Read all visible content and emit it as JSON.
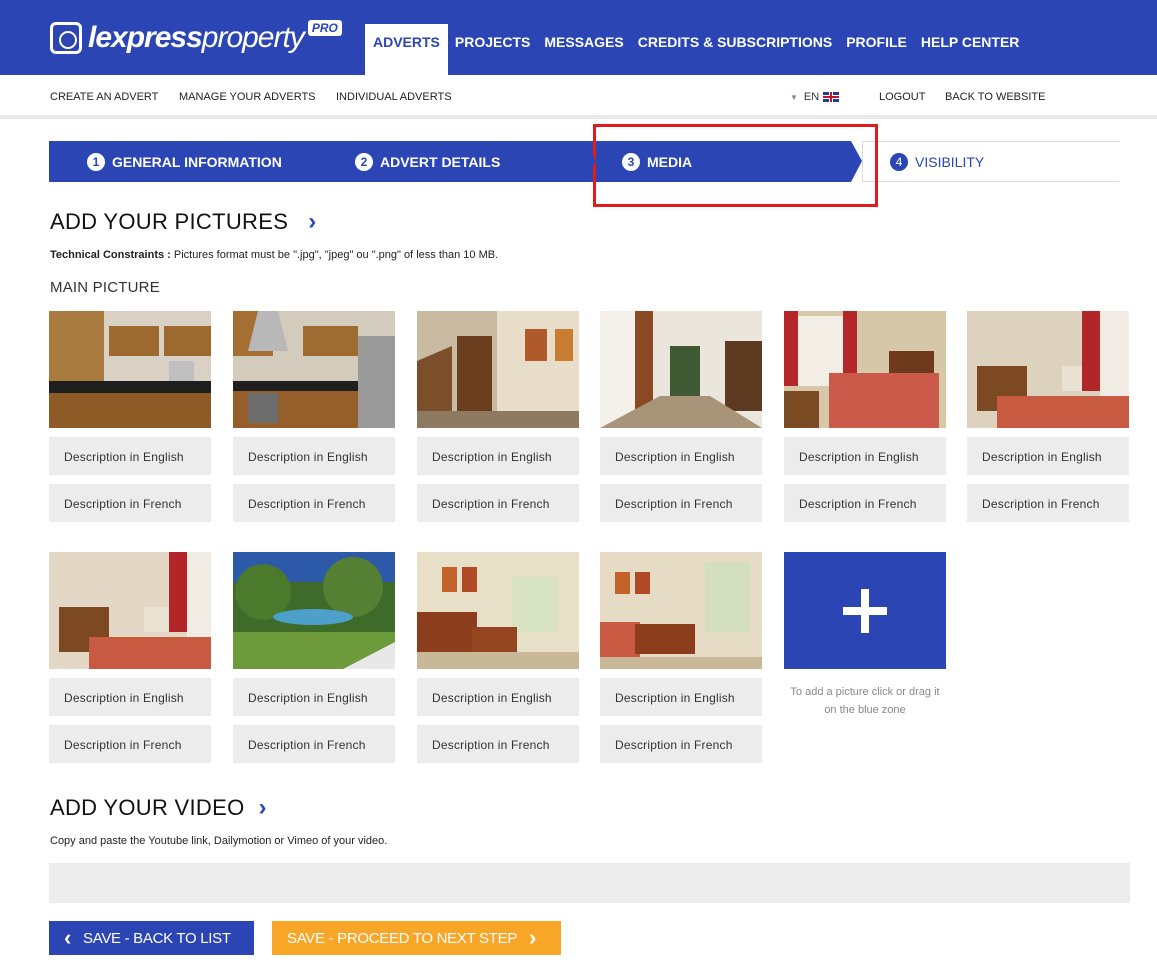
{
  "brand": {
    "name_bold": "lexpress",
    "name_light": "property",
    "badge": "PRO"
  },
  "main_nav": [
    {
      "label": "ADVERTS",
      "active": true
    },
    {
      "label": "PROJECTS"
    },
    {
      "label": "MESSAGES"
    },
    {
      "label": "CREDITS & SUBSCRIPTIONS"
    },
    {
      "label": "PROFILE"
    },
    {
      "label": "HELP CENTER"
    }
  ],
  "sub_nav": {
    "create": "CREATE AN ADVERT",
    "manage": "MANAGE YOUR ADVERTS",
    "individual": "INDIVIDUAL ADVERTS",
    "language": "EN",
    "logout": "LOGOUT",
    "back": "BACK TO WEBSITE"
  },
  "steps": [
    {
      "num": "1",
      "label": "GENERAL INFORMATION"
    },
    {
      "num": "2",
      "label": "ADVERT DETAILS"
    },
    {
      "num": "3",
      "label": "MEDIA"
    },
    {
      "num": "4",
      "label": "VISIBILITY"
    }
  ],
  "pictures_section": {
    "title": "ADD YOUR PICTURES",
    "constraints_label": "Technical Constraints :",
    "constraints_text": " Pictures format must be \".jpg\", \"jpeg\" ou \".png\" of less than 10 MB.",
    "main_picture_label": "MAIN PICTURE",
    "desc_en": "Description in English",
    "desc_fr": "Description in French",
    "add_hint": "To add a picture click or drag it on the blue zone"
  },
  "video_section": {
    "title": "ADD YOUR VIDEO",
    "help": "Copy and paste the Youtube link, Dailymotion or Vimeo of your video.",
    "value": ""
  },
  "buttons": {
    "back": "SAVE - BACK TO LIST",
    "next": "SAVE - PROCEED TO NEXT STEP"
  },
  "colors": {
    "primary": "#2b45b5",
    "accent": "#f7a628",
    "field": "#ececec",
    "highlight": "#e21b1b"
  }
}
